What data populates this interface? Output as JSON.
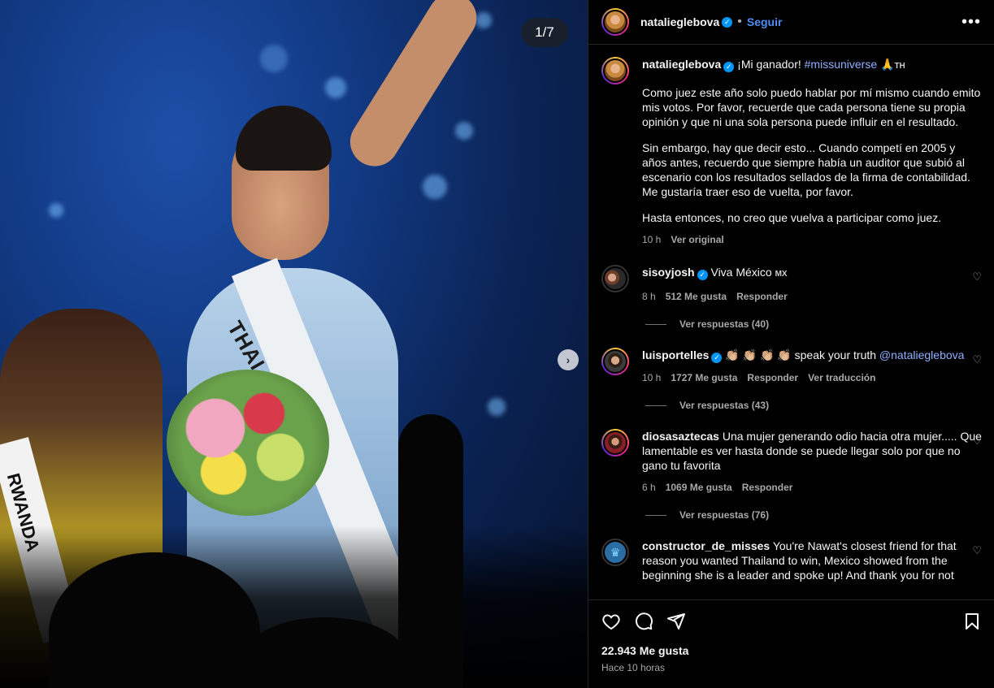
{
  "media": {
    "counter": "1/7",
    "sash_text": "THAI",
    "left_sash_text": "RWANDA"
  },
  "header": {
    "username": "natalieglebova",
    "separator": "•",
    "follow_label": "Seguir",
    "more_icon": "more-horizontal-icon"
  },
  "caption": {
    "username": "natalieglebova",
    "intro": "¡Mi ganador!",
    "hashtag": "#missuniverse",
    "emoji": "🙏",
    "flag": "TH",
    "paragraph1": "Como juez este año solo puedo hablar por mí mismo cuando emito mis votos. Por favor, recuerde que cada persona tiene su propia opinión y que ni una sola persona puede influir en el resultado.",
    "paragraph2": "Sin embargo, hay que decir esto... Cuando competí en 2005 y años antes, recuerdo que siempre había un auditor que subió al escenario con los resultados sellados de la firma de contabilidad. Me gustaría traer eso de vuelta, por favor.",
    "paragraph3": "Hasta entonces, no creo que vuelva a participar como juez.",
    "time": "10 h",
    "see_original": "Ver original"
  },
  "comments": [
    {
      "username": "sisoyjosh",
      "verified": true,
      "text": "Viva México",
      "flag": "MX",
      "time": "8 h",
      "likes": "512 Me gusta",
      "reply": "Responder",
      "translate": "",
      "view_replies": "Ver respuestas (40)"
    },
    {
      "username": "luisportelles",
      "verified": true,
      "text": "👏🏼 👏🏼 👏🏼 👏🏼 speak your truth",
      "mention": "@natalieglebova",
      "time": "10 h",
      "likes": "1727 Me gusta",
      "reply": "Responder",
      "translate": "Ver traducción",
      "view_replies": "Ver respuestas (43)"
    },
    {
      "username": "diosasaztecas",
      "verified": false,
      "text": "Una mujer generando odio hacia otra mujer..... Que lamentable es ver hasta donde se puede llegar solo por que no gano tu favorita",
      "time": "6 h",
      "likes": "1069 Me gusta",
      "reply": "Responder",
      "translate": "",
      "view_replies": "Ver respuestas (76)"
    },
    {
      "username": "constructor_de_misses",
      "verified": false,
      "text": "You're Nawat's closest friend for that reason you wanted Thailand to win, Mexico showed from the beginning she is a leader and spoke up! And thank you for not"
    }
  ],
  "actions": {
    "like_icon": "heart-icon",
    "comment_icon": "comment-icon",
    "share_icon": "send-icon",
    "save_icon": "bookmark-icon",
    "likes_count": "22.943 Me gusta",
    "posted": "Hace 10 horas"
  },
  "colors": {
    "background": "#000000",
    "link": "#8fb0ff",
    "follow": "#4f8cf7",
    "verified": "#0095f6",
    "muted": "#a8a8a8"
  }
}
